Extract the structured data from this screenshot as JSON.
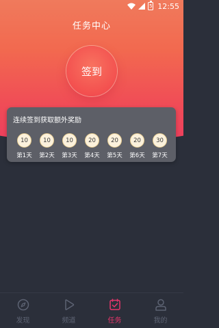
{
  "status_bar": {
    "time": "12:55",
    "battery_glyph": "5"
  },
  "header": {
    "title": "任务中心"
  },
  "checkin": {
    "button_label": "签到"
  },
  "reward": {
    "title": "连续签到获取额外奖励",
    "days": [
      {
        "points": "10",
        "label": "第1天"
      },
      {
        "points": "10",
        "label": "第2天"
      },
      {
        "points": "10",
        "label": "第3天"
      },
      {
        "points": "20",
        "label": "第4天"
      },
      {
        "points": "20",
        "label": "第5天"
      },
      {
        "points": "20",
        "label": "第6天"
      },
      {
        "points": "30",
        "label": "第7天"
      }
    ]
  },
  "tabs": [
    {
      "label": "发现",
      "icon": "compass-icon",
      "active": false
    },
    {
      "label": "频道",
      "icon": "play-icon",
      "active": false
    },
    {
      "label": "任务",
      "icon": "task-check-icon",
      "active": true
    },
    {
      "label": "我的",
      "icon": "user-icon",
      "active": false
    }
  ],
  "colors": {
    "accent": "#e8356b",
    "inactive_tab": "#5d6373",
    "background": "#2b2f3a",
    "card": "#5d5f67",
    "coin_fill": "#fbf1dc",
    "coin_border": "#e9cf94"
  }
}
